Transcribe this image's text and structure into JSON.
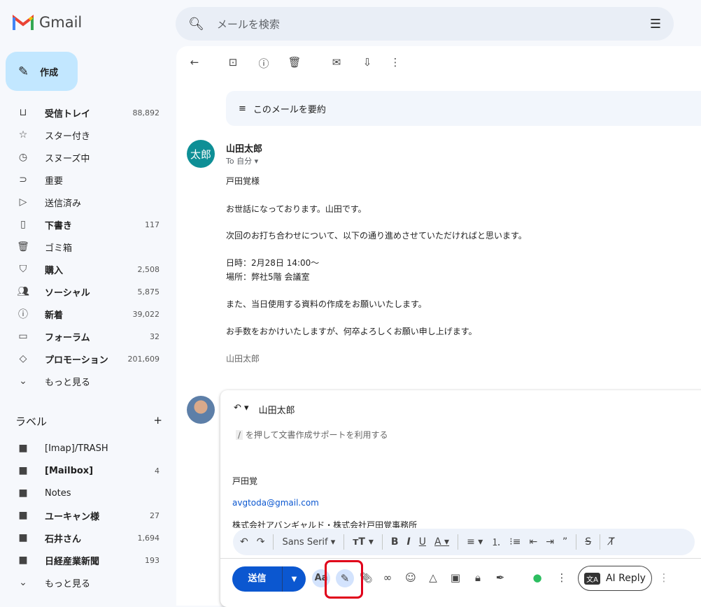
{
  "app": {
    "name": "Gmail"
  },
  "search": {
    "placeholder": "メールを検索"
  },
  "compose": {
    "label": "作成"
  },
  "sidebar": {
    "items": [
      {
        "label": "受信トレイ",
        "count": "88,892",
        "icon": "inbox-icon",
        "bold": true
      },
      {
        "label": "スター付き",
        "count": "",
        "icon": "star-icon",
        "bold": false
      },
      {
        "label": "スヌーズ中",
        "count": "",
        "icon": "clock-icon",
        "bold": false
      },
      {
        "label": "重要",
        "count": "",
        "icon": "important-icon",
        "bold": false
      },
      {
        "label": "送信済み",
        "count": "",
        "icon": "send-icon",
        "bold": false
      },
      {
        "label": "下書き",
        "count": "117",
        "icon": "draft-icon",
        "bold": true
      },
      {
        "label": "ゴミ箱",
        "count": "",
        "icon": "trash-icon",
        "bold": false
      },
      {
        "label": "購入",
        "count": "2,508",
        "icon": "bag-icon",
        "bold": true
      },
      {
        "label": "ソーシャル",
        "count": "5,875",
        "icon": "people-icon",
        "bold": true
      },
      {
        "label": "新着",
        "count": "39,022",
        "icon": "info-icon",
        "bold": true
      },
      {
        "label": "フォーラム",
        "count": "32",
        "icon": "forum-icon",
        "bold": true
      },
      {
        "label": "プロモーション",
        "count": "201,609",
        "icon": "tag-icon",
        "bold": true
      },
      {
        "label": "もっと見る",
        "count": "",
        "icon": "chevron-down-icon",
        "bold": false
      }
    ],
    "labels_title": "ラベル",
    "labels": [
      {
        "label": "[Imap]/TRASH",
        "count": "",
        "bold": false
      },
      {
        "label": "[Mailbox]",
        "count": "4",
        "bold": true
      },
      {
        "label": "Notes",
        "count": "",
        "bold": false
      },
      {
        "label": "ユーキャン様",
        "count": "27",
        "bold": true
      },
      {
        "label": "石井さん",
        "count": "1,694",
        "bold": true
      },
      {
        "label": "日経産業新聞",
        "count": "193",
        "bold": true
      },
      {
        "label": "もっと見る",
        "count": "",
        "bold": false
      }
    ]
  },
  "summary": {
    "label": "このメールを要約"
  },
  "message": {
    "avatar": "太郎",
    "sender": "山田太郎",
    "to": "To 自分",
    "lines": [
      "戸田覚様",
      "お世話になっております。山田です。",
      "次回のお打ち合わせについて、以下の通り進めさせていただければと思います。",
      "日時：2月28日 14:00～",
      "場所：弊社5階 会議室",
      "また、当日使用する資料の作成をお願いいたします。",
      "お手数をおかけいたしますが、何卒よろしくお願い申し上げます。",
      "山田太郎"
    ]
  },
  "reply": {
    "recipient": "山田太郎",
    "hint_key": "/",
    "hint": "を押して文書作成サポートを利用する",
    "sig_name": "戸田覚",
    "sig_email": "avgtoda@gmail.com",
    "sig_company": "株式会社アバンギャルド・株式会社戸田覚事務所",
    "font": "Sans Serif",
    "send": "送信",
    "ai_reply": "AI Reply",
    "formatting": "Aa"
  }
}
